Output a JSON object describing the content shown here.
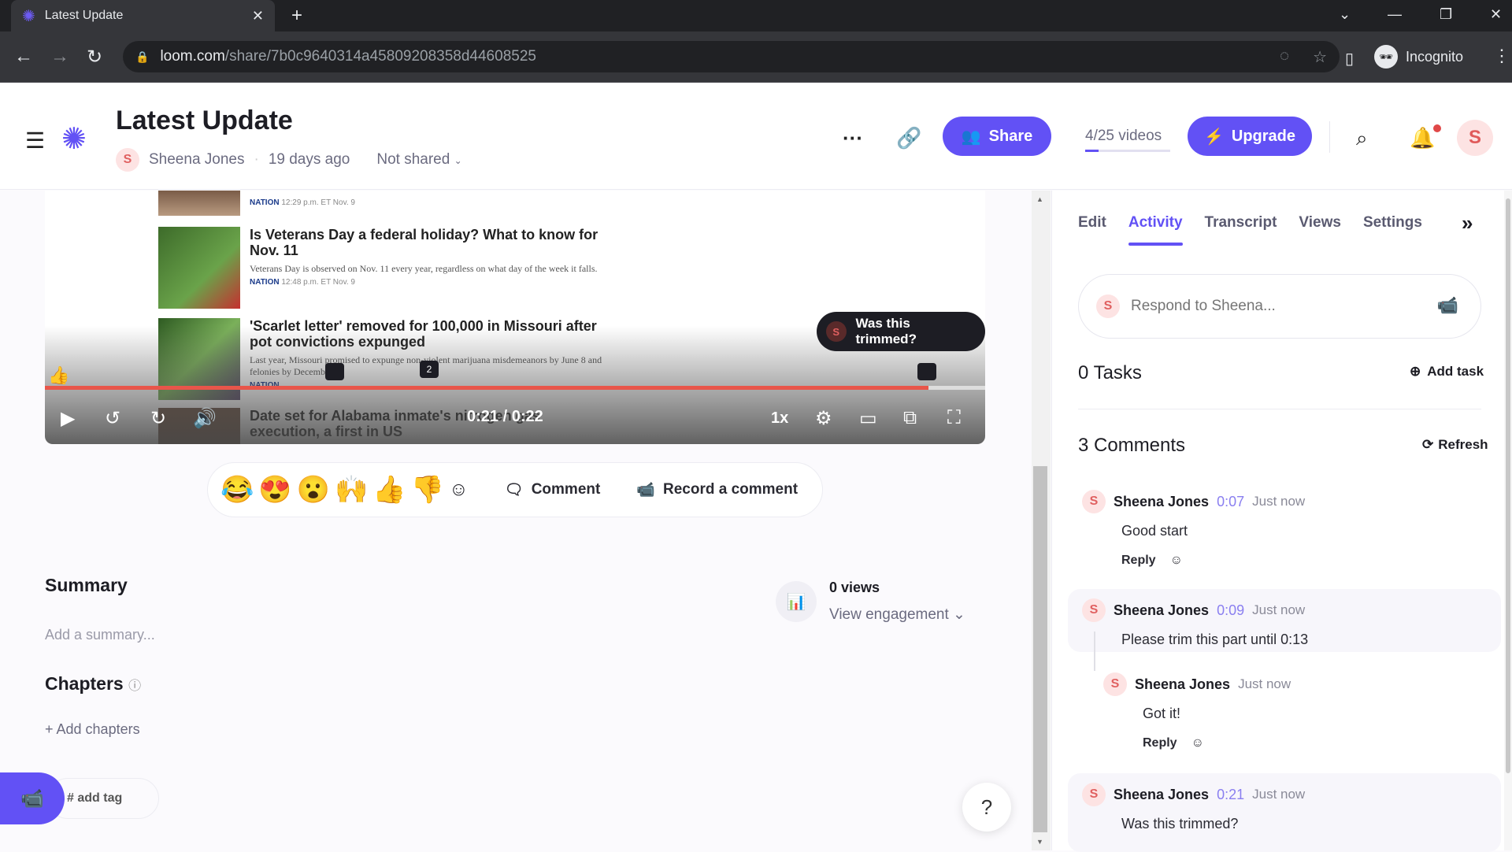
{
  "browser": {
    "tab_title": "Latest Update",
    "url_host": "loom.com",
    "url_path": "/share/7b0c9640314a45809208358d44608525",
    "profile_label": "Incognito"
  },
  "header": {
    "title": "Latest Update",
    "author": "Sheena Jones",
    "author_initial": "S",
    "age": "19 days ago",
    "sharing": "Not shared",
    "share_label": "Share",
    "videos_count": "4/25 videos",
    "videos_used_fraction": 0.16,
    "upgrade_label": "Upgrade",
    "user_initial": "S",
    "colors": {
      "brand": "#6251f5",
      "avatar_bg": "#fde3e3",
      "avatar_fg": "#e05a5a",
      "progress": "#e8554a"
    }
  },
  "video": {
    "articles": [
      {
        "title": "",
        "desc": "",
        "section": "NATION",
        "time": "12:29 p.m. ET Nov. 9"
      },
      {
        "title": "Is Veterans Day a federal holiday? What to know for Nov. 11",
        "desc": "Veterans Day is observed on Nov. 11 every year, regardless on what day of the week it falls.",
        "section": "NATION",
        "time": "12:48 p.m. ET Nov. 9"
      },
      {
        "title": "'Scarlet letter' removed for 100,000 in Missouri after pot convictions expunged",
        "desc": "Last year, Missouri promised to expunge non-violent marijuana misdemeanors by June 8 and felonies by December 8.",
        "section": "NATION",
        "time": ""
      },
      {
        "title": "Date set for Alabama inmate's nitrogen gas execution, a first in US",
        "desc": "",
        "section": "",
        "time": ""
      }
    ],
    "current_time": "0:21",
    "duration": "0:22",
    "progress_fraction": 0.94,
    "speed": "1x",
    "pin_count_label": "2",
    "tooltip_initial": "S",
    "tooltip_text": "Was this trimmed?"
  },
  "reactions": {
    "emojis": [
      "😂",
      "😍",
      "😮",
      "🙌",
      "👍",
      "👎"
    ],
    "comment_label": "Comment",
    "record_label": "Record a comment"
  },
  "details": {
    "summary_heading": "Summary",
    "summary_placeholder": "Add a summary...",
    "chapters_heading": "Chapters",
    "add_chapters": "+ Add chapters",
    "views_count": "0 views",
    "view_engagement": "View engagement",
    "add_tag": "# add tag",
    "help": "?"
  },
  "panel": {
    "tabs": [
      "Edit",
      "Activity",
      "Transcript",
      "Views",
      "Settings"
    ],
    "active_tab": "Activity",
    "respond_placeholder": "Respond to Sheena...",
    "tasks_label": "0 Tasks",
    "add_task": "Add task",
    "comments_label": "3 Comments",
    "refresh": "Refresh",
    "comments": [
      {
        "author": "Sheena Jones",
        "initial": "S",
        "timestamp": "0:07",
        "when": "Just now",
        "text": "Good start",
        "reply": "Reply"
      },
      {
        "author": "Sheena Jones",
        "initial": "S",
        "timestamp": "0:09",
        "when": "Just now",
        "text": "Please trim this part until 0:13",
        "reply": ""
      },
      {
        "author": "Sheena Jones",
        "initial": "S",
        "timestamp": "",
        "when": "Just now",
        "text": "Got it!",
        "reply": "Reply"
      },
      {
        "author": "Sheena Jones",
        "initial": "S",
        "timestamp": "0:21",
        "when": "Just now",
        "text": "Was this trimmed?",
        "reply": ""
      }
    ]
  }
}
